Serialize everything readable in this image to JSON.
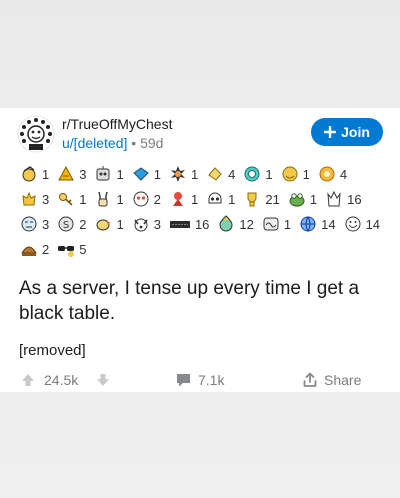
{
  "post": {
    "subreddit": "r/TrueOffMyChest",
    "author": "u/[deleted]",
    "separator": "•",
    "age": "59d",
    "join_label": "Join",
    "title": "As a server, I tense up every time I get a black table.",
    "body": "[removed]"
  },
  "awards": [
    {
      "icon": "salute-icon",
      "count": "1"
    },
    {
      "icon": "gold-pyramid-icon",
      "count": "3"
    },
    {
      "icon": "robot-face-icon",
      "count": "1"
    },
    {
      "icon": "blue-diamond-icon",
      "count": "1"
    },
    {
      "icon": "starburst-icon",
      "count": "1"
    },
    {
      "icon": "wholesome-hand-icon",
      "count": "4"
    },
    {
      "icon": "teal-coin-icon",
      "count": "1"
    },
    {
      "icon": "gold-face-icon",
      "count": "1"
    },
    {
      "icon": "gold-flower-icon",
      "count": "4"
    },
    {
      "icon": "clapping-hands-icon",
      "count": "3"
    },
    {
      "icon": "key-icon",
      "count": "1"
    },
    {
      "icon": "peace-hand-icon",
      "count": "1"
    },
    {
      "icon": "heart-eyes-icon",
      "count": "2"
    },
    {
      "icon": "red-mascot-icon",
      "count": "1"
    },
    {
      "icon": "skull-icon",
      "count": "1"
    },
    {
      "icon": "gold-trophy-icon",
      "count": "21"
    },
    {
      "icon": "frog-icon",
      "count": "1"
    },
    {
      "icon": "raised-hands-icon",
      "count": "16"
    },
    {
      "icon": "eye-roll-face-icon",
      "count": "3"
    },
    {
      "icon": "s-coin-icon",
      "count": "2"
    },
    {
      "icon": "yellow-bird-icon",
      "count": "1"
    },
    {
      "icon": "dog-icon",
      "count": "3"
    },
    {
      "icon": "dark-banner-icon",
      "count": "16"
    },
    {
      "icon": "party-face-icon",
      "count": "12"
    },
    {
      "icon": "wave-face-icon",
      "count": "1"
    },
    {
      "icon": "globe-icon",
      "count": "14"
    },
    {
      "icon": "happy-face-icon",
      "count": "14"
    },
    {
      "icon": "pie-icon",
      "count": "2"
    },
    {
      "icon": "sunglasses-icon",
      "count": "5"
    }
  ],
  "actions": {
    "score": "24.5k",
    "comments": "7.1k",
    "share_label": "Share"
  }
}
